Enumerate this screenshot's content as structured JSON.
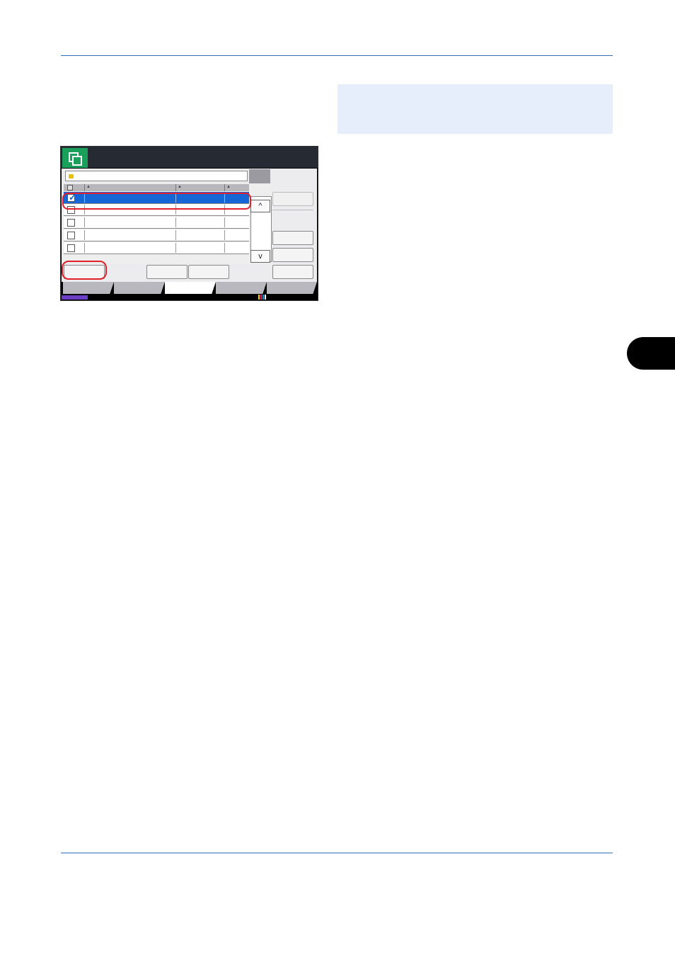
{
  "page": {
    "note_box": "",
    "chapter_tab": ""
  },
  "panel": {
    "header_title": "",
    "path_value": "",
    "list": {
      "columns": [
        "",
        "",
        ""
      ],
      "rows": [
        {
          "selected": true,
          "checked": true
        },
        {
          "selected": false,
          "checked": false
        },
        {
          "selected": false,
          "checked": false
        },
        {
          "selected": false,
          "checked": false
        },
        {
          "selected": false,
          "checked": false
        }
      ]
    },
    "scroll_up_symbol": "^",
    "scroll_down_symbol": "v",
    "check_symbol": "✓",
    "sort_symbol": "▲",
    "tabs": [
      {
        "label": "",
        "active": false
      },
      {
        "label": "",
        "active": false
      },
      {
        "label": "",
        "active": true
      },
      {
        "label": "",
        "active": false
      },
      {
        "label": "",
        "active": false
      }
    ],
    "icons": {
      "app": "document-box-icon",
      "folder": "folder-icon",
      "toner": "toner-level-icon"
    },
    "colors": {
      "header_bg": "#262a33",
      "app_icon_bg": "#1aa05a",
      "selection": "#1666d6",
      "highlight_outline": "#e0202a",
      "status_purple": "#6a3fc6",
      "rule_blue": "#2f6fb5",
      "note_bg": "#e6eefc"
    }
  }
}
